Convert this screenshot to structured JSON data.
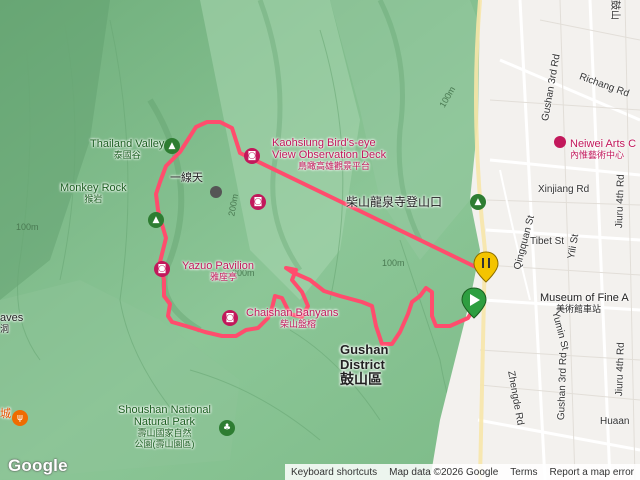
{
  "map": {
    "pois": [
      {
        "id": "thailand-valley",
        "name": "Thailand Valley",
        "zh": "泰國谷",
        "color": "#1b5e20"
      },
      {
        "id": "yi-xian-tian",
        "name": "",
        "zh": "一線天",
        "color": "#222222"
      },
      {
        "id": "monkey-rock",
        "name": "Monkey Rock",
        "zh": "猴岩",
        "color": "#1b5e20"
      },
      {
        "id": "yazuo-pavilion",
        "name": "Yazuo Pavilion",
        "zh": "雅座亭",
        "color": "#c2185b"
      },
      {
        "id": "chaishan-banyans",
        "name": "Chaishan Banyans",
        "zh": "柴山盤榕",
        "color": "#c2185b"
      },
      {
        "id": "birds-eye-deck",
        "name": "Kaohsiung Bird's-eye View Observation Deck",
        "name_line1": "Kaohsiung Bird's-eye",
        "name_line2": "View Observation Deck",
        "zh": "鳥瞰高雄觀景平台",
        "color": "#c2185b"
      },
      {
        "id": "longquan-temple",
        "name": "",
        "zh": "柴山龍泉寺登山口",
        "color": "#222222"
      },
      {
        "id": "shoushan-park",
        "name": "Shoushan National Natural Park",
        "name_line1": "Shoushan National",
        "name_line2": "Natural Park",
        "zh": "壽山國家自然",
        "zh2": "公園(壽山園區)",
        "color": "#1b5e20"
      },
      {
        "id": "neiwei-arts",
        "name": "Neiwei Arts C",
        "zh": "內惟藝術中心",
        "color": "#c2185b"
      },
      {
        "id": "museum-fine-arts",
        "name": "Museum of Fine A",
        "zh": "美術館車站",
        "color": "#222222"
      }
    ],
    "district": {
      "name": "Gushan District",
      "name_line1": "Gushan",
      "name_line2": "District",
      "zh": "鼓山區"
    },
    "partial_labels": {
      "left_caves": "aves",
      "left_caves_zh": "洞",
      "left_cheng": "城",
      "top_right_zh": "鼓山"
    },
    "streets": [
      "Richang Rd",
      "Gushan 3rd Rd",
      "Xinjiang Rd",
      "Jiuru 4th Rd",
      "Tibet St",
      "Qingquan St",
      "Yili St",
      "Yumin St",
      "Zhengde Rd",
      "Huaan",
      "Jiuru 4th Rd",
      "Gushan 3rd Rd"
    ],
    "contours": [
      "100m",
      "200m",
      "100m",
      "100m",
      "200m"
    ]
  },
  "footer": {
    "logo": "Google",
    "keyboard": "Keyboard shortcuts",
    "mapdata": "Map data ©2026 Google",
    "terms": "Terms",
    "report": "Report a map error"
  },
  "colors": {
    "terrain": "#7fb98a",
    "track": "#ff4d6d",
    "city": "#f3f1ee",
    "roads": "#ffffff",
    "poi_pink": "#c2185b",
    "poi_green": "#2e7d32"
  }
}
